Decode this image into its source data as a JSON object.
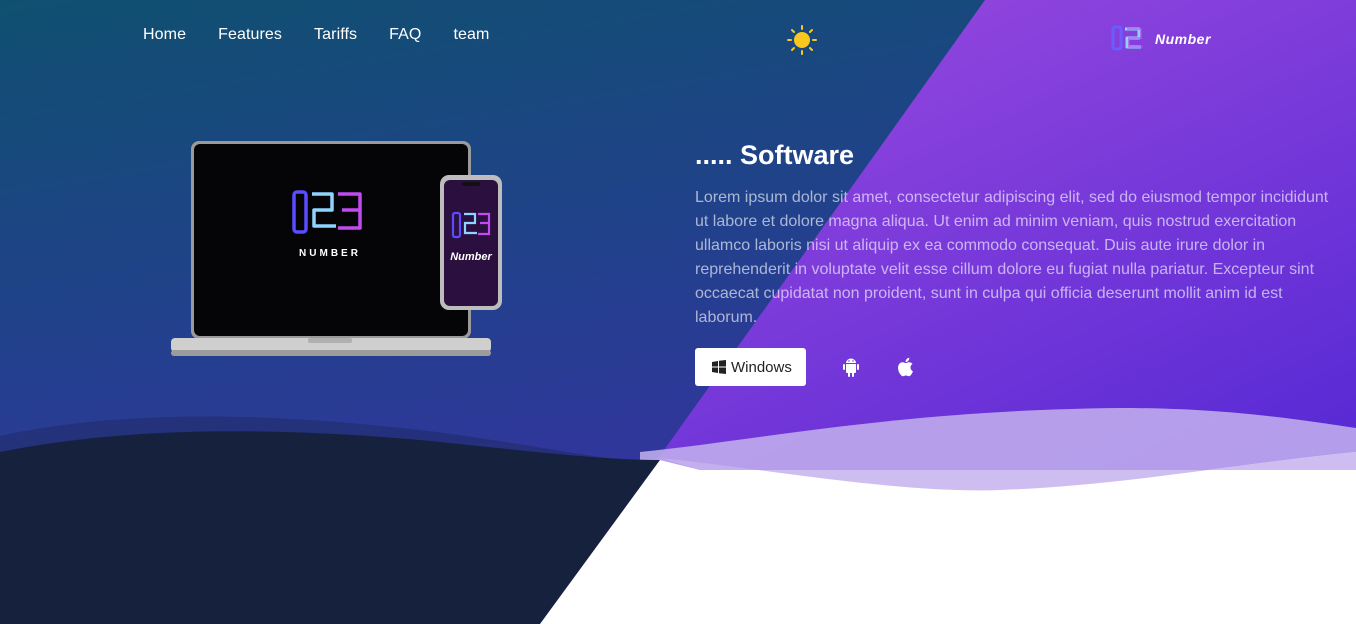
{
  "nav": {
    "items": [
      {
        "label": "Home"
      },
      {
        "label": "Features"
      },
      {
        "label": "Tariffs"
      },
      {
        "label": "FAQ"
      },
      {
        "label": "team"
      }
    ]
  },
  "theme_toggle": {
    "icon": "sun-icon",
    "color": "#f9c71d"
  },
  "brand": {
    "logo_icon": "123-logo-icon",
    "name": "Number"
  },
  "hero": {
    "title": "..... Software",
    "description": "Lorem ipsum dolor sit amet, consectetur adipiscing elit, sed do eiusmod tempor incididunt ut labore et dolore magna aliqua. Ut enim ad minim veniam, quis nostrud exercitation ullamco laboris nisi ut aliquip ex ea commodo consequat. Duis aute irure dolor in reprehenderit in voluptate velit esse cillum dolore eu fugiat nulla pariatur. Excepteur sint occaecat cupidatat non proident, sunt in culpa qui officia deserunt mollit anim id est laborum.",
    "device_screen_text": "NUMBER",
    "device_phone_text": "Number"
  },
  "downloads": {
    "windows_label": "Windows",
    "windows_icon": "windows-icon",
    "android_icon": "android-icon",
    "apple_icon": "apple-icon"
  },
  "colors": {
    "left_gradient_top": "#134e6f",
    "left_gradient_bottom": "#3a2f9e",
    "right_gradient_top": "#a24fe0",
    "right_gradient_bottom": "#5b2ad6",
    "dark_wave": "#16213e",
    "light_wave": "#b49ce6"
  }
}
